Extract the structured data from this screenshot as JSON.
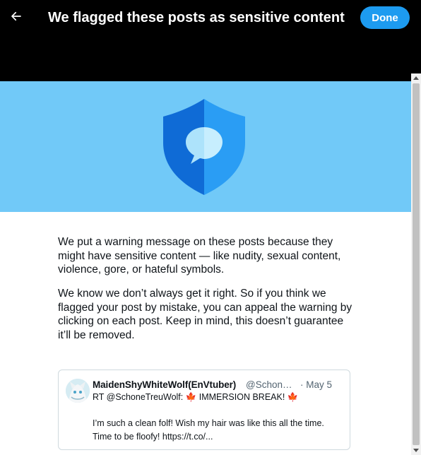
{
  "header": {
    "title": "We flagged these posts as sensitive content",
    "done_label": "Done",
    "back_icon": "arrow-left-icon"
  },
  "hero": {
    "icon": "shield-chat-icon",
    "background": "#71c9f8"
  },
  "body": {
    "paragraph1": "We put a warning message on these posts because they might have sensitive content — like nudity, sexual content, violence, gore, or hateful symbols.",
    "paragraph2": "We know we don’t always get it right. So if you think we flagged your post by mistake, you can appeal the warning by clicking on each post. Keep in mind, this doesn’t guarantee it’ll be removed."
  },
  "post": {
    "display_name": "MaidenShyWhiteWolf(EnVtuber)",
    "handle": "@SchoneTreuWolf",
    "date": "· May 5",
    "retweet_line": "RT @SchoneTreuWolf: 🍁 IMMERSION BREAK! 🍁",
    "text": "I’m such a clean folf!  Wish my hair was like this all the time. Time to be floofy! https://t.co/..."
  },
  "colors": {
    "accent": "#1d9bf0",
    "header_bg": "#000000",
    "shield_dark": "#0f6bd6",
    "shield_light": "#2a9df4"
  }
}
